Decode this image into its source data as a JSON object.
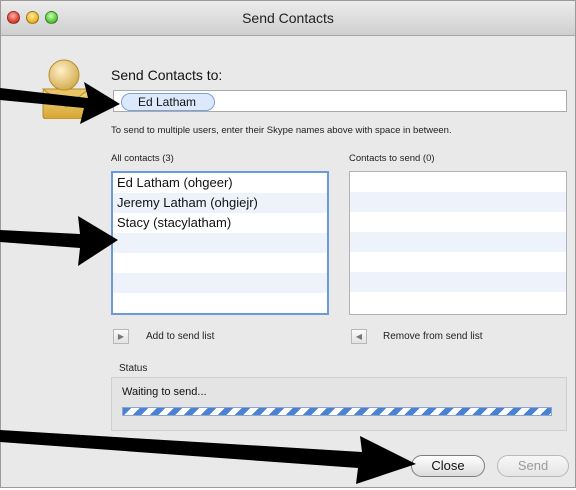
{
  "window": {
    "title": "Send Contacts"
  },
  "heading": "Send Contacts to:",
  "to_field": {
    "token": "Ed Latham"
  },
  "hint": "To send to multiple users, enter their Skype names above with space in between.",
  "all_contacts": {
    "label": "All contacts (3)",
    "items": [
      "Ed Latham (ohgeer)",
      "Jeremy Latham (ohgiejr)",
      "Stacy (stacylatham)"
    ]
  },
  "contacts_to_send": {
    "label": "Contacts to send (0)"
  },
  "buttons": {
    "add": "Add to send list",
    "remove": "Remove from send list",
    "close": "Close",
    "send": "Send"
  },
  "status": {
    "title": "Status",
    "text": "Waiting to send..."
  },
  "icons": {
    "avatar": "contacts-avatar-icon",
    "add": "play-right-icon",
    "remove": "play-left-icon"
  },
  "colors": {
    "accent": "#6a9ad9",
    "progress": "#4c80d0",
    "arrow": "#000000"
  }
}
